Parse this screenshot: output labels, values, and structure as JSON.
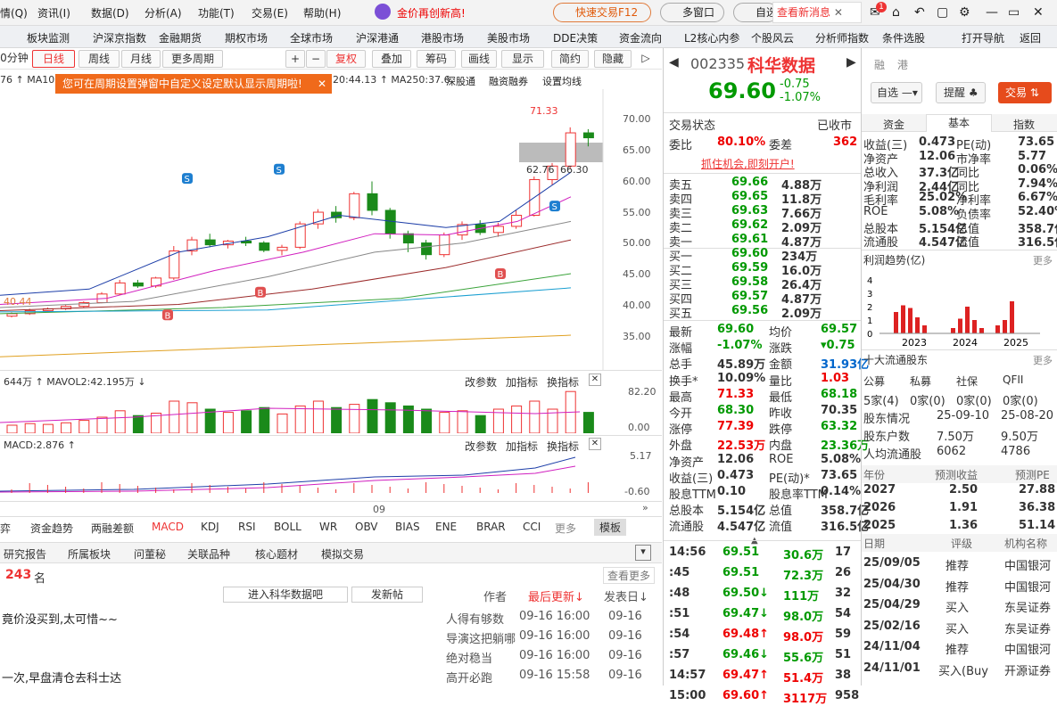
{
  "menu": {
    "items": [
      "情(Q)",
      "资讯(I)",
      "数据(D)",
      "分析(A)",
      "功能(T)",
      "交易(E)",
      "帮助(H)"
    ],
    "promo": "金价再创新高!",
    "fast_trade": "快速交易F12",
    "multi_window": "多窗口",
    "self": "自选",
    "news": "查看新消息",
    "badge": "1"
  },
  "nav": [
    "板块监测",
    "沪深京指数",
    "金融期货",
    "期权市场",
    "全球市场",
    "沪深港通",
    "港股市场",
    "美股市场",
    "DDE决策",
    "资金流向",
    "L2核心内参",
    "个股风云",
    "分析师指数",
    "条件选股",
    "打开导航",
    "返回"
  ],
  "period": {
    "tabs": [
      "0分钟",
      "日线",
      "周线",
      "月线",
      "更多周期"
    ],
    "restore": "复权",
    "overlay": "叠加",
    "chip": "筹码",
    "draw": "画线",
    "display": "显示",
    "simple": "简约",
    "hide": "隐藏"
  },
  "ma": {
    "left": "76 ↑ MA10:",
    "mid": "20:44.13 ↑ MA250:37.6",
    "tags": [
      "深股通",
      "融资融券",
      "设置均线"
    ]
  },
  "tip": "您可在周期设置弹窗中自定义设定默认显示周期啦!",
  "price_axis": [
    "70.00",
    "65.00",
    "60.00",
    "55.00",
    "50.00",
    "45.00",
    "40.00",
    "35.00"
  ],
  "annot": {
    "high": "71.33",
    "range": "62.76",
    "cur": "66.30",
    "low": "40.44"
  },
  "vol": {
    "label": "644万 ↑ MAVOL2:42.195万 ↓",
    "axis": [
      "82.20",
      "0.00"
    ],
    "btns": [
      "改参数",
      "加指标",
      "换指标"
    ]
  },
  "macd": {
    "label": "MACD:2.876 ↑",
    "axis": [
      "5.17",
      "-0.60"
    ],
    "btns": [
      "改参数",
      "加指标",
      "换指标"
    ]
  },
  "date_label": "09",
  "ind_tabs": [
    "弈",
    "资金趋势",
    "两融差额",
    "MACD",
    "KDJ",
    "RSI",
    "BOLL",
    "WR",
    "OBV",
    "BIAS",
    "ENE",
    "BRAR",
    "CCI",
    "更多",
    "模板"
  ],
  "btabs": [
    "研究报告",
    "所属板块",
    "问董秘",
    "关联品种",
    "核心题材",
    "模拟交易"
  ],
  "forum": {
    "count": "243",
    "unit": "名",
    "more": "查看更多",
    "enter": "进入科华数据吧",
    "post": "发新帖",
    "cols": [
      "作者",
      "最后更新↓",
      "发表日↓"
    ],
    "rows": [
      {
        "t": "竟价没买到,太可惜~~",
        "a": "人得有够数",
        "u": "09-16 16:00",
        "d": "09-16"
      },
      {
        "t": "",
        "a": "导演这把躺哪",
        "u": "09-16 16:00",
        "d": "09-16"
      },
      {
        "t": "",
        "a": "绝对稳当",
        "u": "09-16 16:00",
        "d": "09-16"
      },
      {
        "t": "一次,早盘清仓去科士达",
        "a": "高开必跑",
        "u": "09-16 15:58",
        "d": "09-16"
      }
    ]
  },
  "stock": {
    "code": "002335",
    "name": "科华数据",
    "tags": [
      "融",
      "港"
    ],
    "price": "69.60",
    "chg": "-0.75",
    "pct": "-1.07%",
    "watch": "自选",
    "alert": "提醒",
    "trade": "交易"
  },
  "status": {
    "label": "交易状态",
    "value": "已收市",
    "wb_l": "委比",
    "wb": "80.10%",
    "wc_l": "委差",
    "wc": "362",
    "ad": "抓住机会,即刻开户!"
  },
  "sells": [
    [
      "卖五",
      "69.66",
      "4.88万"
    ],
    [
      "卖四",
      "69.65",
      "11.8万"
    ],
    [
      "卖三",
      "69.63",
      "7.66万"
    ],
    [
      "卖二",
      "69.62",
      "2.09万"
    ],
    [
      "卖一",
      "69.61",
      "4.87万"
    ]
  ],
  "buys": [
    [
      "买一",
      "69.60",
      "234万"
    ],
    [
      "买二",
      "69.59",
      "16.0万"
    ],
    [
      "买三",
      "69.58",
      "26.4万"
    ],
    [
      "买四",
      "69.57",
      "4.87万"
    ],
    [
      "买五",
      "69.56",
      "2.09万"
    ]
  ],
  "quote": [
    [
      "最新",
      "69.60",
      "均价",
      "69.57"
    ],
    [
      "涨幅",
      "-1.07%",
      "涨跌",
      "▾0.75"
    ],
    [
      "总手",
      "45.89万",
      "金额",
      "31.93亿"
    ],
    [
      "换手*",
      "10.09%",
      "量比",
      "1.03"
    ],
    [
      "最高",
      "71.33",
      "最低",
      "68.18"
    ],
    [
      "今开",
      "68.30",
      "昨收",
      "70.35"
    ],
    [
      "涨停",
      "77.39",
      "跌停",
      "63.32"
    ],
    [
      "外盘",
      "22.53万",
      "内盘",
      "23.36万"
    ],
    [
      "净资产",
      "12.06",
      "ROE",
      "5.08%"
    ],
    [
      "收益(三)",
      "0.473",
      "PE(动)*",
      "73.65"
    ],
    [
      "股息TTM",
      "0.10",
      "股息率TTM",
      "0.14%"
    ],
    [
      "总股本",
      "5.154亿",
      "总值",
      "358.7亿"
    ],
    [
      "流通股",
      "4.547亿",
      "流值",
      "316.5亿"
    ]
  ],
  "ticks": [
    [
      "14:56",
      "69.51",
      "30.6万",
      "17"
    ],
    [
      ":45",
      "69.51",
      "72.3万",
      "26"
    ],
    [
      ":48",
      "69.50↓",
      "111万",
      "32"
    ],
    [
      ":51",
      "69.47↓",
      "98.0万",
      "54"
    ],
    [
      ":54",
      "69.48↑",
      "98.0万",
      "59"
    ],
    [
      ":57",
      "69.46↓",
      "55.6万",
      "51"
    ],
    [
      "14:57",
      "69.47↑",
      "51.4万",
      "38"
    ],
    [
      "15:00",
      "69.60↑",
      "3117万",
      "958"
    ]
  ],
  "ftabs": [
    "资金",
    "基本",
    "指数"
  ],
  "fund": [
    [
      "收益(三)",
      "0.473",
      "PE(动)",
      "73.65"
    ],
    [
      "净资产",
      "12.06",
      "市净率",
      "5.77"
    ],
    [
      "总收入",
      "37.3亿",
      "同比",
      "0.06%"
    ],
    [
      "净利润",
      "2.44亿",
      "同比",
      "7.94%"
    ],
    [
      "毛利率",
      "25.02%",
      "净利率",
      "6.67%"
    ],
    [
      "ROE",
      "5.08%",
      "负债率",
      "52.40%"
    ],
    [
      "总股本",
      "5.154亿",
      "总值",
      "358.7亿"
    ],
    [
      "流通股",
      "4.547亿",
      "流值",
      "316.5亿"
    ]
  ],
  "profit": {
    "title": "利润趋势(亿)",
    "more": "更多",
    "yaxis": [
      "4",
      "3",
      "2",
      "1",
      "0"
    ],
    "years": [
      "2023",
      "2024",
      "2025"
    ]
  },
  "holders": {
    "title": "十大流通股东",
    "more": "更多",
    "types": [
      "公募",
      "私募",
      "社保",
      "QFII"
    ],
    "counts": [
      "5家(4)",
      "0家(0)",
      "0家(0)",
      "0家(0)"
    ],
    "rows": [
      [
        "股东情况",
        "25-09-10",
        "25-08-20"
      ],
      [
        "股东户数",
        "7.50万",
        "9.50万"
      ],
      [
        "人均流通股",
        "6062",
        "4786"
      ]
    ]
  },
  "forecast": {
    "cols": [
      "年份",
      "预测收益",
      "预测PE"
    ],
    "rows": [
      [
        "2027",
        "2.50",
        "27.88"
      ],
      [
        "2026",
        "1.91",
        "36.38"
      ],
      [
        "2025",
        "1.36",
        "51.14"
      ]
    ]
  },
  "ratings": {
    "cols": [
      "日期",
      "评级",
      "机构名称"
    ],
    "rows": [
      [
        "25/09/05",
        "推荐",
        "中国银河"
      ],
      [
        "25/04/30",
        "推荐",
        "中国银河"
      ],
      [
        "25/04/29",
        "买入",
        "东吴证券"
      ],
      [
        "25/02/16",
        "买入",
        "东吴证券"
      ],
      [
        "24/11/04",
        "推荐",
        "中国银河"
      ],
      [
        "24/11/01",
        "买入(Buy",
        "开源证券"
      ]
    ]
  }
}
